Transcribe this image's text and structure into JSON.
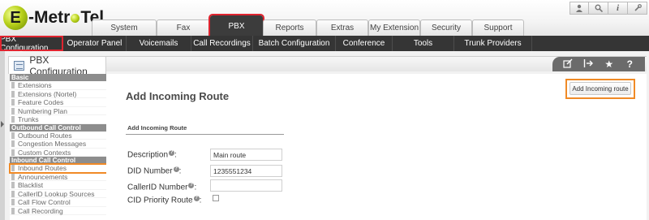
{
  "header": {
    "logo_left": "E",
    "logo_mid": "-Metr",
    "logo_right": "Tel",
    "tabs": [
      {
        "label": "System"
      },
      {
        "label": "Fax"
      },
      {
        "label": "PBX"
      },
      {
        "label": "Reports"
      },
      {
        "label": "Extras"
      },
      {
        "label": "My Extension"
      },
      {
        "label": "Security"
      },
      {
        "label": "Support"
      }
    ],
    "top_icons": [
      "user-icon",
      "search-icon",
      "info-icon",
      "wrench-icon"
    ]
  },
  "submenu": {
    "items": [
      {
        "label": "PBX Configuration"
      },
      {
        "label": "Operator Panel"
      },
      {
        "label": "Voicemails"
      },
      {
        "label": "Call Recordings"
      },
      {
        "label": "Batch Configuration"
      },
      {
        "label": "Conference"
      },
      {
        "label": "Tools"
      },
      {
        "label": "Trunk Providers"
      }
    ]
  },
  "module": {
    "title": "PBX Configuration",
    "actions": [
      "edit-icon",
      "export-icon",
      "star-icon",
      "help-icon"
    ]
  },
  "sidebar": {
    "groups": [
      {
        "title": "Basic",
        "items": [
          "Extensions",
          "Extensions (Nortel)",
          "Feature Codes",
          "Numbering Plan",
          "Trunks"
        ]
      },
      {
        "title": "Outbound Call Control",
        "items": [
          "Outbound Routes",
          "Congestion Messages",
          "Custom Contexts"
        ]
      },
      {
        "title": "Inbound Call Control",
        "items": [
          "Inbound Routes",
          "Announcements",
          "Blacklist",
          "CallerID Lookup Sources",
          "Call Flow Control",
          "Call Recording"
        ]
      }
    ]
  },
  "content": {
    "page_title": "Add Incoming Route",
    "section_label": "Add Incoming Route",
    "add_button": "Add Incoming route",
    "fields": {
      "description_label": "Description",
      "description_value": "Main route",
      "did_label": "DID Number",
      "did_value": "1235551234",
      "callerid_label": "CallerID Number",
      "callerid_value": "",
      "cid_priority_label": "CID Priority Route",
      "cid_priority_checked": false
    }
  },
  "colors": {
    "highlight_red": "#e0242f",
    "highlight_orange": "#f08a26",
    "submenu_bg": "#353535",
    "logo_green": "#b9d21c"
  }
}
